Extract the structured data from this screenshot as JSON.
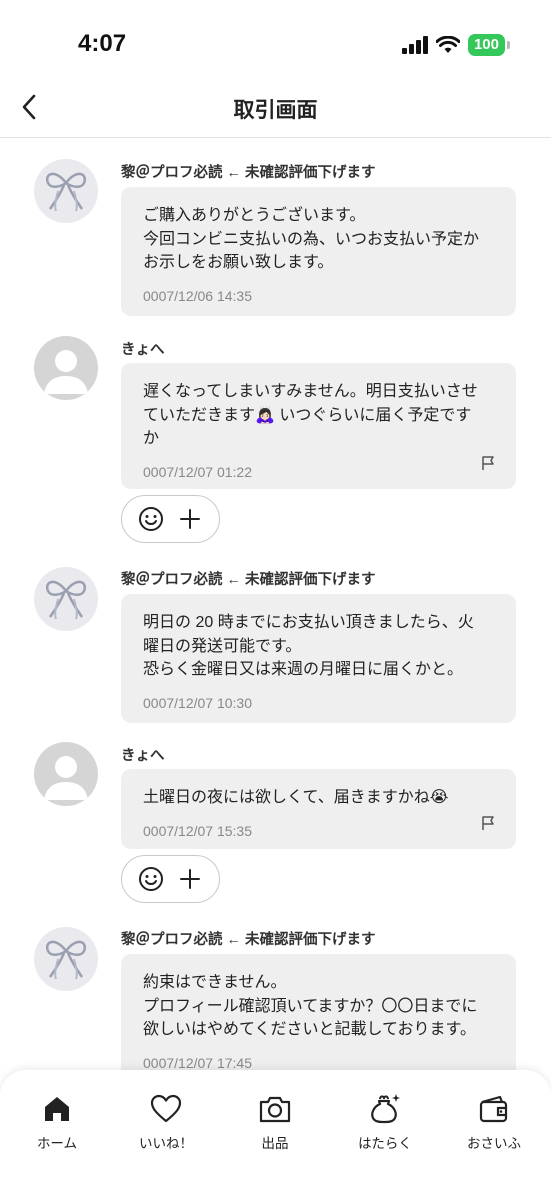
{
  "status_bar": {
    "time": "4:07",
    "battery": "100"
  },
  "nav": {
    "title": "取引画面"
  },
  "messages": [
    {
      "sender": "黎＠プロフ必読 ← 未確認評価下げます",
      "text": "ご購入ありがとうございます。\n今回コンビニ支払いの為、いつお支払い予定か\nお示しをお願い致します。",
      "time": "0007/12/06 14:35",
      "role": "seller"
    },
    {
      "sender": "きょへ",
      "text": "遅くなってしまいすみません。明日支払いさせ\nていただきます🙇🏻‍♀️ いつぐらいに届く予定です\nか",
      "time": "0007/12/07 01:22",
      "role": "buyer"
    },
    {
      "sender": "黎＠プロフ必読 ← 未確認評価下げます",
      "text": "明日の 20 時までにお支払い頂きましたら、火\n曜日の発送可能です。\n恐らく金曜日又は来週の月曜日に届くかと。",
      "time": "0007/12/07 10:30",
      "role": "seller"
    },
    {
      "sender": "きょへ",
      "text": "土曜日の夜には欲しくて、届きますかね😭",
      "time": "0007/12/07 15:35",
      "role": "buyer"
    },
    {
      "sender": "黎＠プロフ必読 ← 未確認評価下げます",
      "text": "約束はできません。\nプロフィール確認頂いてますか？〇〇日までに\n欲しいはやめてくださいと記載しております。",
      "time": "0007/12/07 17:45",
      "role": "seller"
    }
  ],
  "tabs": [
    {
      "label": "ホーム",
      "icon": "home-icon"
    },
    {
      "label": "いいね！",
      "icon": "heart-icon"
    },
    {
      "label": "出品",
      "icon": "camera-icon"
    },
    {
      "label": "はたらく",
      "icon": "money-bag-icon"
    },
    {
      "label": "おさいふ",
      "icon": "wallet-icon"
    }
  ]
}
